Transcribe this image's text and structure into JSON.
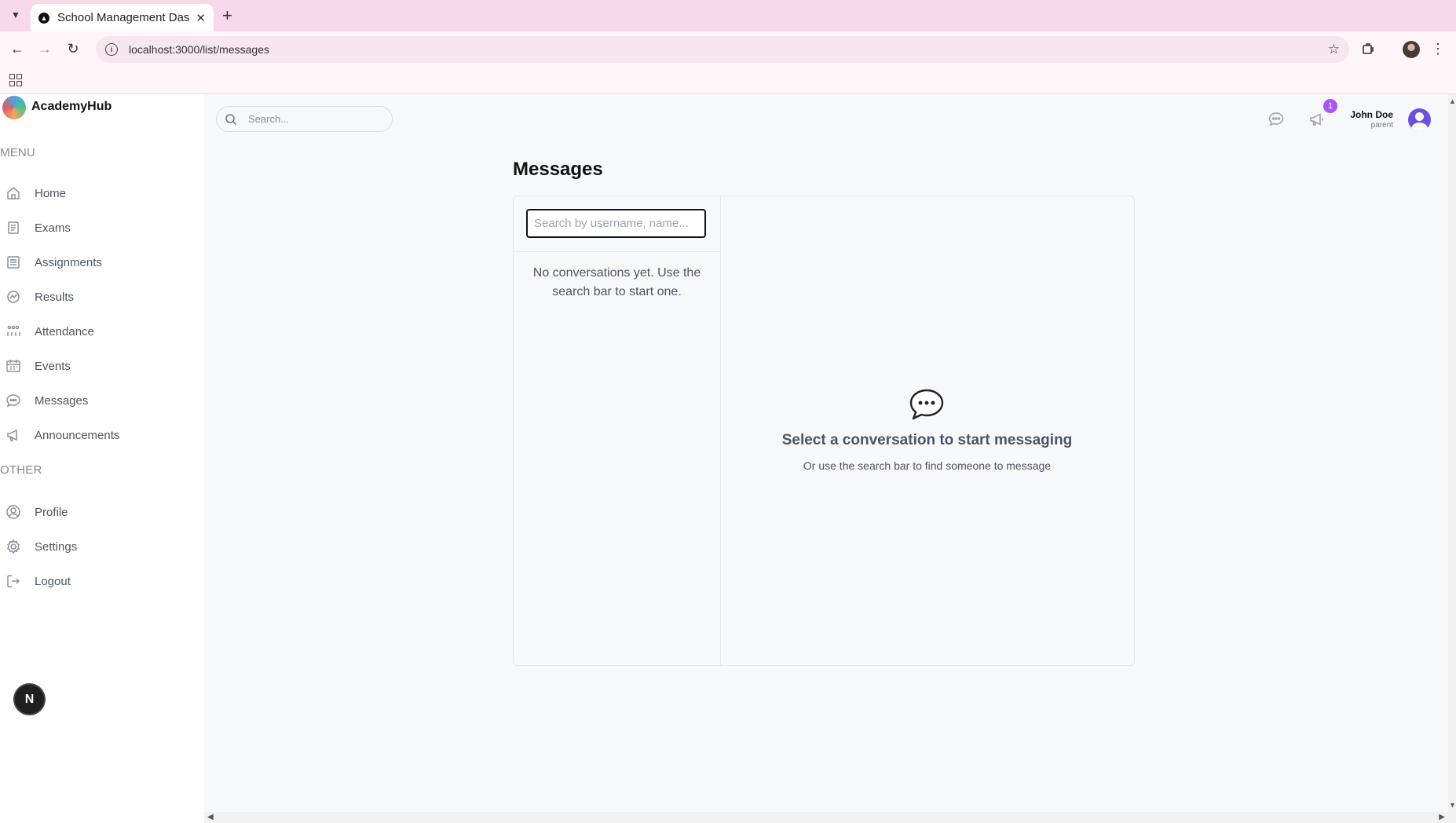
{
  "browser": {
    "tab_title": "School Management Das",
    "url": "localhost:3000/list/messages"
  },
  "app": {
    "brand": "AcademyHub",
    "search_placeholder": "Search...",
    "notification_count": "1",
    "user": {
      "name": "John Doe",
      "role": "parent"
    },
    "next_badge": "N"
  },
  "sidebar": {
    "menu_label": "MENU",
    "other_label": "OTHER",
    "menu_items": [
      {
        "label": "Home",
        "icon": "home-icon"
      },
      {
        "label": "Exams",
        "icon": "exam-icon"
      },
      {
        "label": "Assignments",
        "icon": "assignment-icon"
      },
      {
        "label": "Results",
        "icon": "results-icon"
      },
      {
        "label": "Attendance",
        "icon": "attendance-icon"
      },
      {
        "label": "Events",
        "icon": "calendar-icon"
      },
      {
        "label": "Messages",
        "icon": "message-icon"
      },
      {
        "label": "Announcements",
        "icon": "megaphone-icon"
      }
    ],
    "other_items": [
      {
        "label": "Profile",
        "icon": "profile-icon"
      },
      {
        "label": "Settings",
        "icon": "gear-icon"
      },
      {
        "label": "Logout",
        "icon": "logout-icon"
      }
    ]
  },
  "messages": {
    "title": "Messages",
    "search_placeholder": "Search by username, name...",
    "empty_list": "No conversations yet. Use the search bar to start one.",
    "empty_chat_title": "Select a conversation to start messaging",
    "empty_chat_subtitle": "Or use the search bar to find someone to message"
  }
}
